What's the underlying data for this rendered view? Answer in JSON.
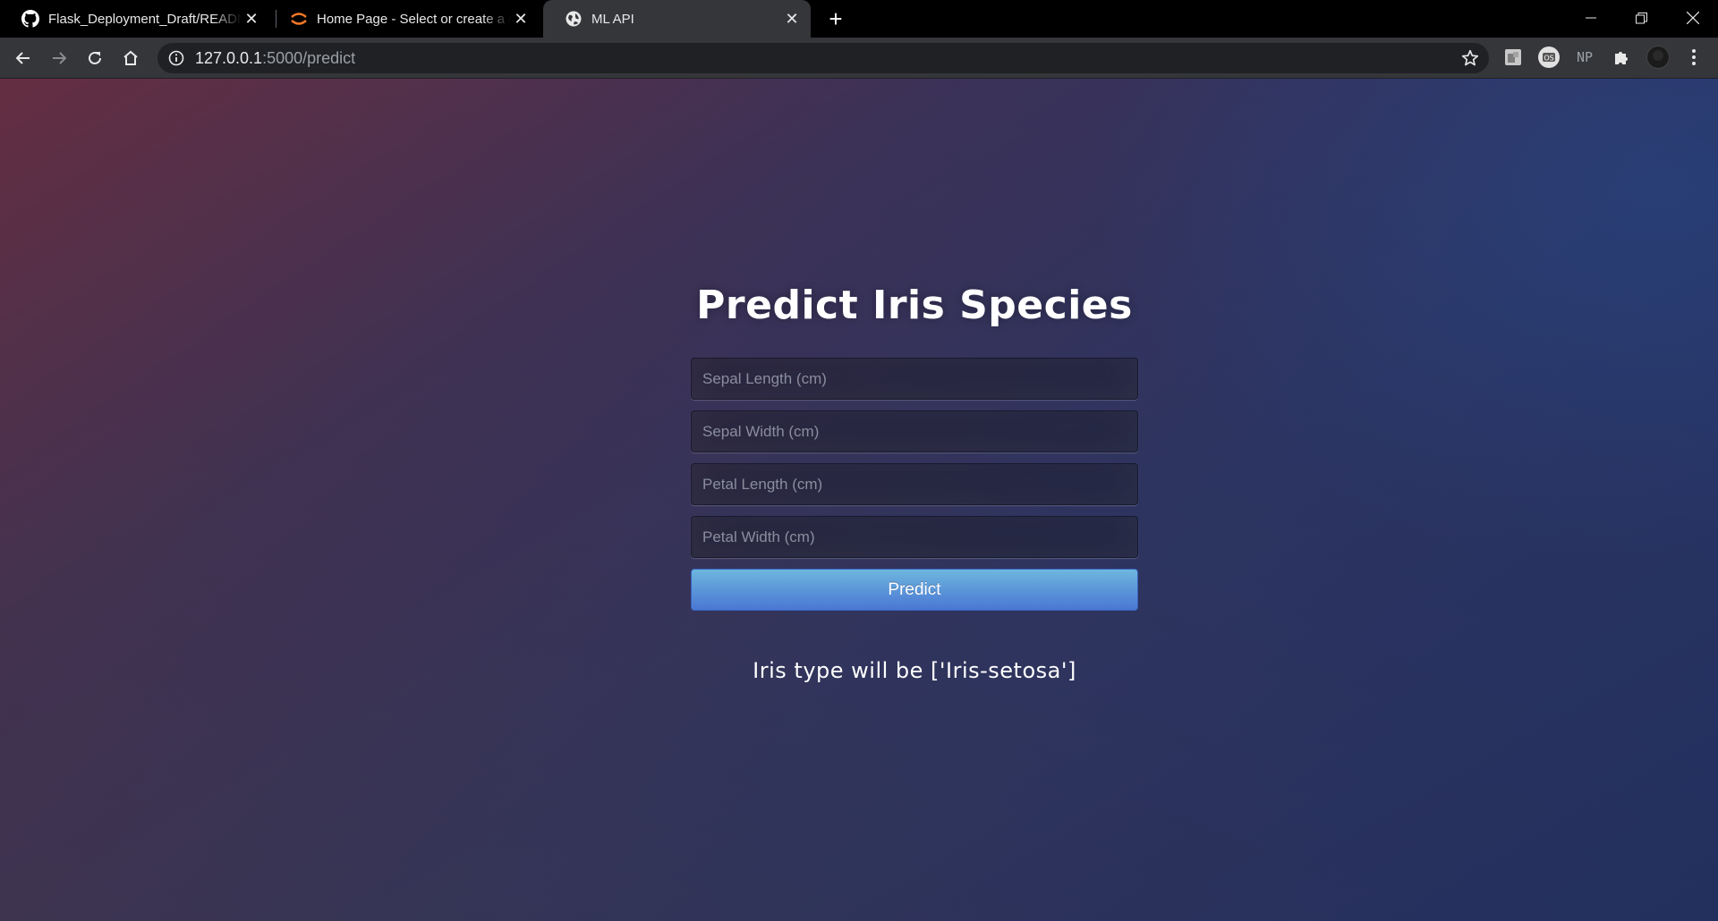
{
  "browser": {
    "tabs": [
      {
        "title": "Flask_Deployment_Draft/README",
        "icon": "github-icon",
        "active": false
      },
      {
        "title": "Home Page - Select or create a n",
        "icon": "jupyter-icon",
        "active": false
      },
      {
        "title": "ML API",
        "icon": "globe-icon",
        "active": true
      }
    ],
    "address": {
      "host": "127.0.0.1",
      "path": ":5000/predict"
    },
    "extensions": [
      "extension-icon",
      "profile-os-icon",
      "np-extension-icon",
      "puzzle-icon",
      "avatar-icon"
    ],
    "np_label": "NP",
    "os_label": "OS"
  },
  "page": {
    "title": "Predict Iris Species",
    "fields": {
      "sepal_length": {
        "placeholder": "Sepal Length (cm)",
        "value": ""
      },
      "sepal_width": {
        "placeholder": "Sepal Width (cm)",
        "value": ""
      },
      "petal_length": {
        "placeholder": "Petal Length (cm)",
        "value": ""
      },
      "petal_width": {
        "placeholder": "Petal Width (cm)",
        "value": ""
      }
    },
    "button_label": "Predict",
    "result": "Iris type will be ['Iris-setosa']"
  },
  "colors": {
    "button_top": "#6eb6de",
    "button_bottom": "#4a77d4",
    "tab_active": "#35363a"
  }
}
